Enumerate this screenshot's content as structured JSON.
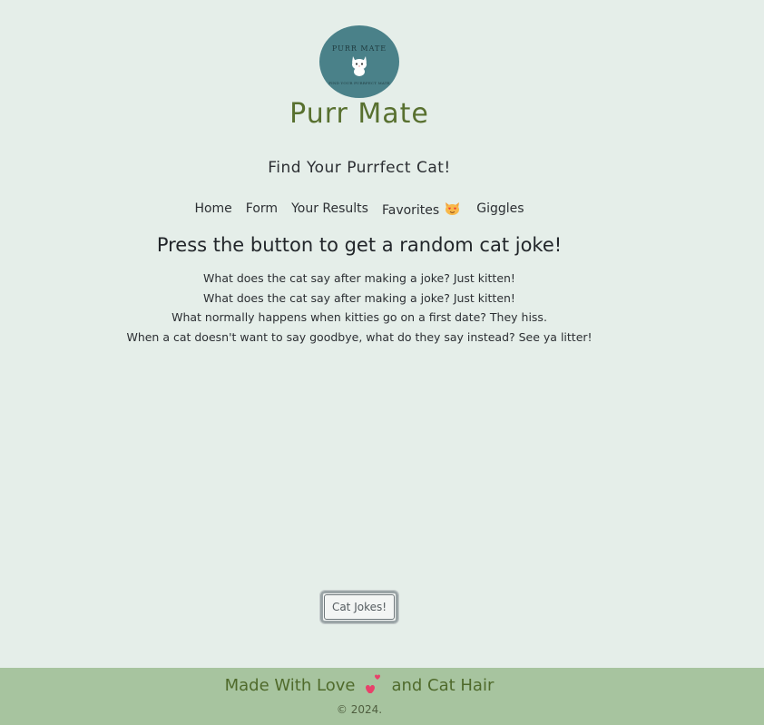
{
  "logo": {
    "arc_text": "PURR MATE",
    "tagline": "FIND YOUR PURRFECT MATE",
    "icon": "cat-icon",
    "bg_color": "#4a8189"
  },
  "brand": {
    "title": "Purr Mate",
    "color": "#58702f"
  },
  "tagline": "Find Your Purrfect Cat!",
  "nav": {
    "items": [
      {
        "label": "Home"
      },
      {
        "label": "Form"
      },
      {
        "label": "Your Results"
      },
      {
        "label": "Favorites",
        "icon": "heart-eyes-cat-icon"
      },
      {
        "label": "Giggles"
      }
    ]
  },
  "main": {
    "heading": "Press the button to get a random cat joke!",
    "jokes": [
      "What does the cat say after making a joke? Just kitten!",
      "What does the cat say after making a joke? Just kitten!",
      "What normally happens when kitties go on a first date? They hiss.",
      "When a cat doesn't want to say goodbye, what do they say instead? See ya litter!"
    ],
    "button_label": "Cat Jokes!"
  },
  "footer": {
    "made_before": "Made With Love",
    "made_icon": "two-hearts-icon",
    "made_after": "and Cat Hair",
    "copyright": "© 2024.",
    "bg_color": "#a7c49f"
  },
  "colors": {
    "page_bg": "#e5eee9",
    "heart": "#e8416a"
  }
}
